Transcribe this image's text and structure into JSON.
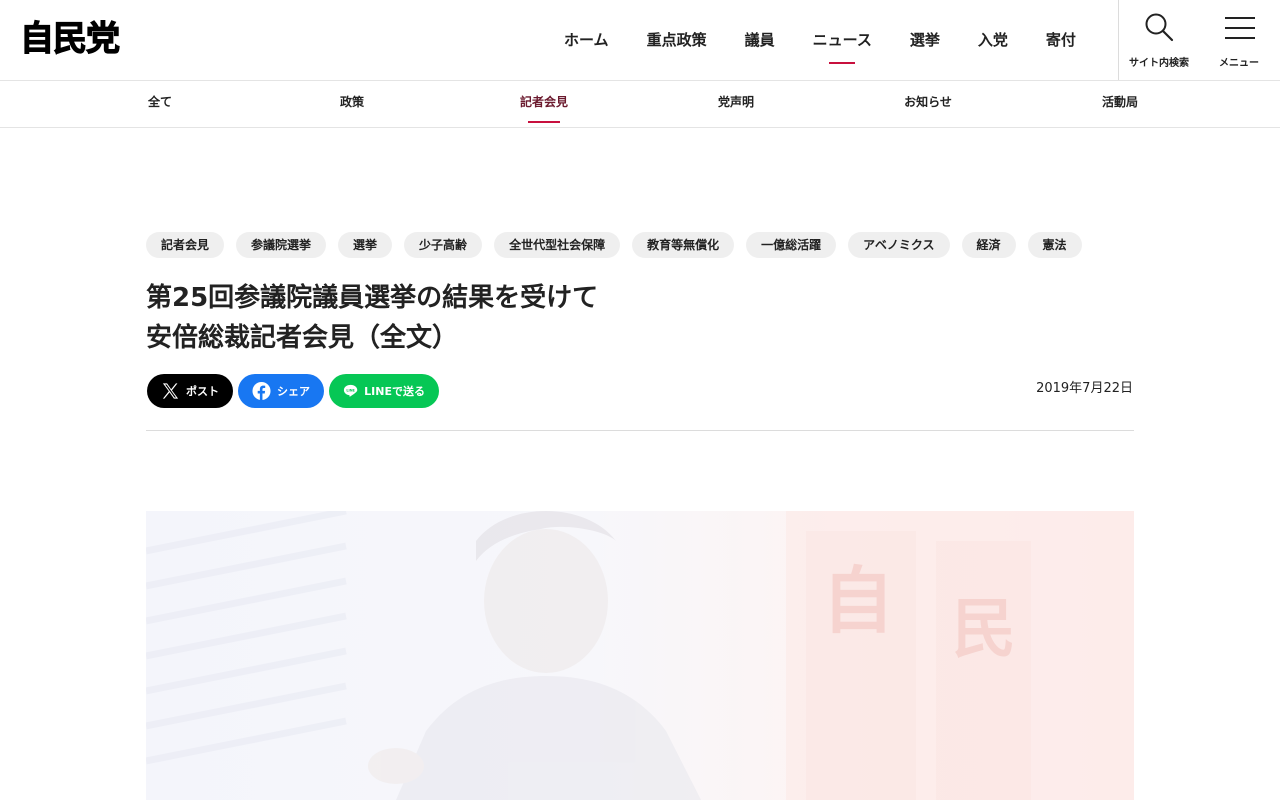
{
  "logo": {
    "text": "自民党"
  },
  "global_nav": [
    {
      "label": "ホーム",
      "active": false
    },
    {
      "label": "重点政策",
      "active": false
    },
    {
      "label": "議員",
      "active": false
    },
    {
      "label": "ニュース",
      "active": true
    },
    {
      "label": "選挙",
      "active": false
    },
    {
      "label": "入党",
      "active": false
    },
    {
      "label": "寄付",
      "active": false
    }
  ],
  "utility": {
    "search_label": "サイト内検索",
    "menu_label": "メニュー"
  },
  "sub_nav": [
    {
      "label": "全て",
      "active": false
    },
    {
      "label": "政策",
      "active": false
    },
    {
      "label": "記者会見",
      "active": true
    },
    {
      "label": "党声明",
      "active": false
    },
    {
      "label": "お知らせ",
      "active": false
    },
    {
      "label": "活動局",
      "active": false
    }
  ],
  "tags": [
    "記者会見",
    "参議院選挙",
    "選挙",
    "少子高齢",
    "全世代型社会保障",
    "教育等無償化",
    "一億総活躍",
    "アベノミクス",
    "経済",
    "憲法"
  ],
  "article": {
    "title_line1": "第25回参議院議員選挙の結果を受けて",
    "title_line2": "安倍総裁記者会見（全文）",
    "date": "2019年7月22日"
  },
  "share": {
    "x_label": "ポスト",
    "facebook_label": "シェア",
    "line_label": "LINEで送る",
    "line_icon_text": "LINE"
  },
  "photo_signage": [
    "自",
    "民"
  ],
  "colors": {
    "accent": "#c8103e",
    "x": "#000000",
    "facebook": "#1877f2",
    "line": "#06c755",
    "tag_bg": "#efefef"
  }
}
